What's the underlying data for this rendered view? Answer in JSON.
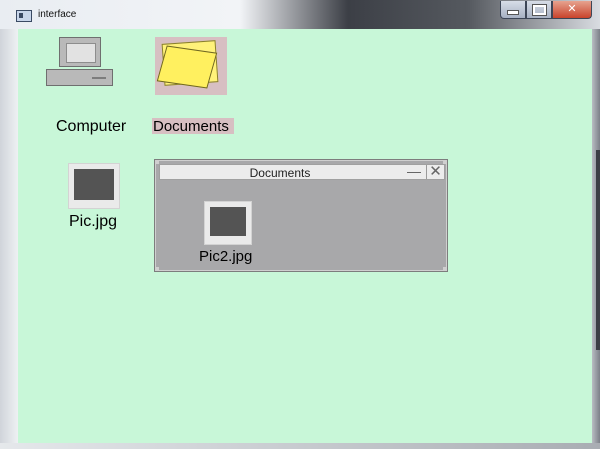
{
  "window": {
    "title": "interface",
    "controls": {
      "minimize": "minimize-icon",
      "maximize": "maximize-icon",
      "close": "close-icon"
    }
  },
  "desktop": {
    "background": "#c8f7d8",
    "icons": [
      {
        "label": "Computer",
        "icon": "computer-icon"
      },
      {
        "label": "Documents",
        "icon": "folder-icon",
        "selected": true
      },
      {
        "label": "Pic.jpg",
        "icon": "image-file-icon"
      }
    ]
  },
  "documents_window": {
    "title": "Documents",
    "minimize_glyph": "—",
    "close_glyph": "✕",
    "items": [
      {
        "label": "Pic2.jpg",
        "icon": "image-file-icon"
      }
    ]
  },
  "colors": {
    "desktop_bg": "#c8f7d8",
    "selection": "#d7bfc2",
    "inner_window_bg": "#a8a8aa",
    "folder_yellow": "#fff05f"
  }
}
